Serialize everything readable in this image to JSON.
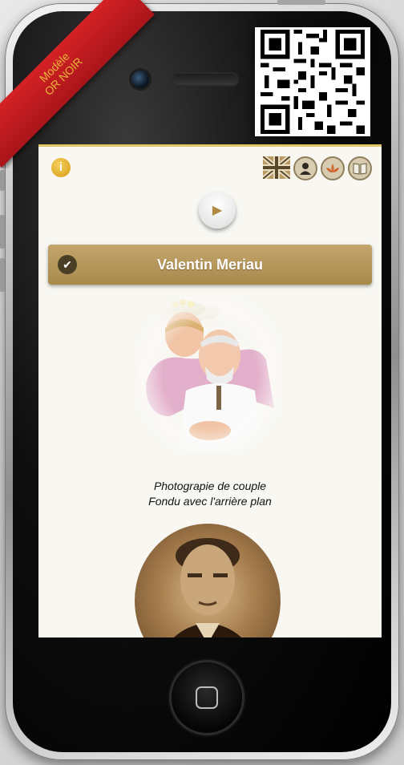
{
  "ribbon": {
    "line1": "Modèle",
    "line2": "OR NOIR"
  },
  "toolbar": {
    "info_glyph": "i",
    "icons": [
      "uk-flag-icon",
      "person-icon",
      "lotus-icon",
      "book-icon"
    ]
  },
  "profile": {
    "name": "Valentin Meriau",
    "caption_line1": "Photograpie de couple",
    "caption_line2": "Fondu avec l'arrière plan"
  },
  "colors": {
    "accent_gold": "#b39455",
    "ribbon_red": "#c41b20",
    "screen_bg": "#f8f7f2"
  }
}
